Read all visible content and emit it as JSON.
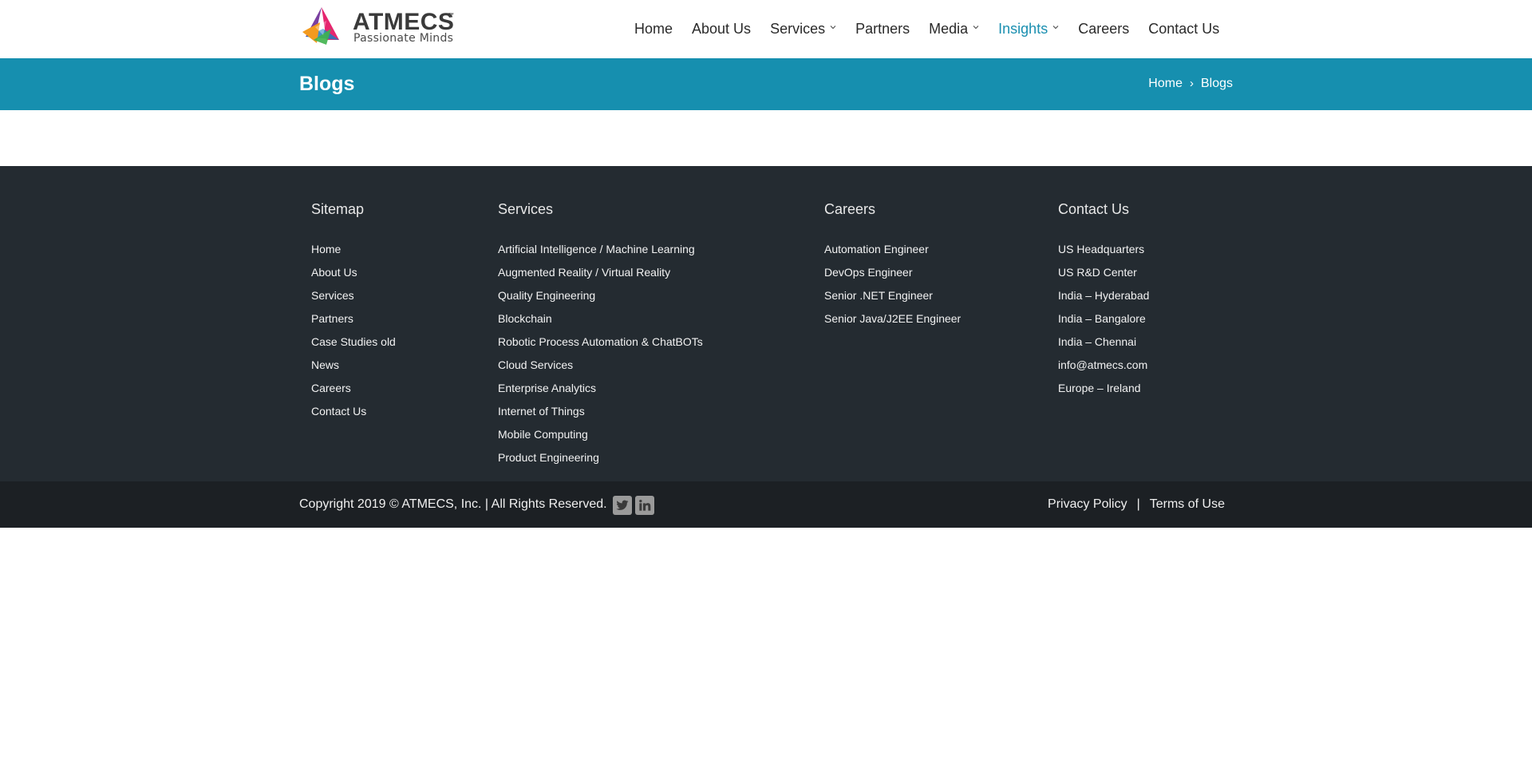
{
  "brand": {
    "name": "ATMECS",
    "trademark": "™",
    "tagline": "Passionate Minds",
    "colors": {
      "pink": "#e6266f",
      "purple": "#7a3fa0",
      "orange": "#f39a1e",
      "green": "#3fb24c",
      "blue": "#1e7cc0"
    }
  },
  "nav": {
    "items": [
      {
        "label": "Home"
      },
      {
        "label": "About Us"
      },
      {
        "label": "Services",
        "dropdown": true
      },
      {
        "label": "Partners"
      },
      {
        "label": "Media",
        "dropdown": true
      },
      {
        "label": "Insights",
        "dropdown": true,
        "active": true
      },
      {
        "label": "Careers"
      },
      {
        "label": "Contact Us"
      }
    ]
  },
  "page": {
    "title": "Blogs",
    "breadcrumb": {
      "home": "Home",
      "separator": "›",
      "current": "Blogs"
    }
  },
  "footer": {
    "sitemap": {
      "heading": "Sitemap",
      "items": [
        "Home",
        "About Us",
        "Services",
        "Partners",
        "Case Studies old",
        "News",
        "Careers",
        "Contact Us"
      ]
    },
    "services": {
      "heading": "Services",
      "items": [
        "Artificial Intelligence / Machine Learning",
        "Augmented Reality / Virtual Reality",
        "Quality Engineering",
        "Blockchain",
        "Robotic Process Automation & ChatBOTs",
        "Cloud Services",
        "Enterprise Analytics",
        "Internet of Things",
        "Mobile Computing",
        "Product Engineering"
      ]
    },
    "careers": {
      "heading": "Careers",
      "items": [
        "Automation Engineer",
        "DevOps Engineer",
        "Senior .NET Engineer",
        "Senior Java/J2EE Engineer"
      ]
    },
    "contact": {
      "heading": "Contact Us",
      "items": [
        "US Headquarters",
        "US R&D Center",
        "India – Hyderabad",
        "India – Bangalore",
        "India – Chennai",
        "info@atmecs.com",
        "Europe – Ireland"
      ]
    }
  },
  "bottom": {
    "copyright": "Copyright 2019 © ATMECS, Inc. | All Rights Reserved.",
    "social": [
      {
        "icon": "twitter-icon"
      },
      {
        "icon": "linkedin-icon"
      }
    ],
    "privacy": "Privacy Policy",
    "separator": "|",
    "terms": "Terms of Use"
  },
  "colors": {
    "accent": "#168faf",
    "footer_bg": "#242b31",
    "bottom_bg": "#1c2024"
  }
}
